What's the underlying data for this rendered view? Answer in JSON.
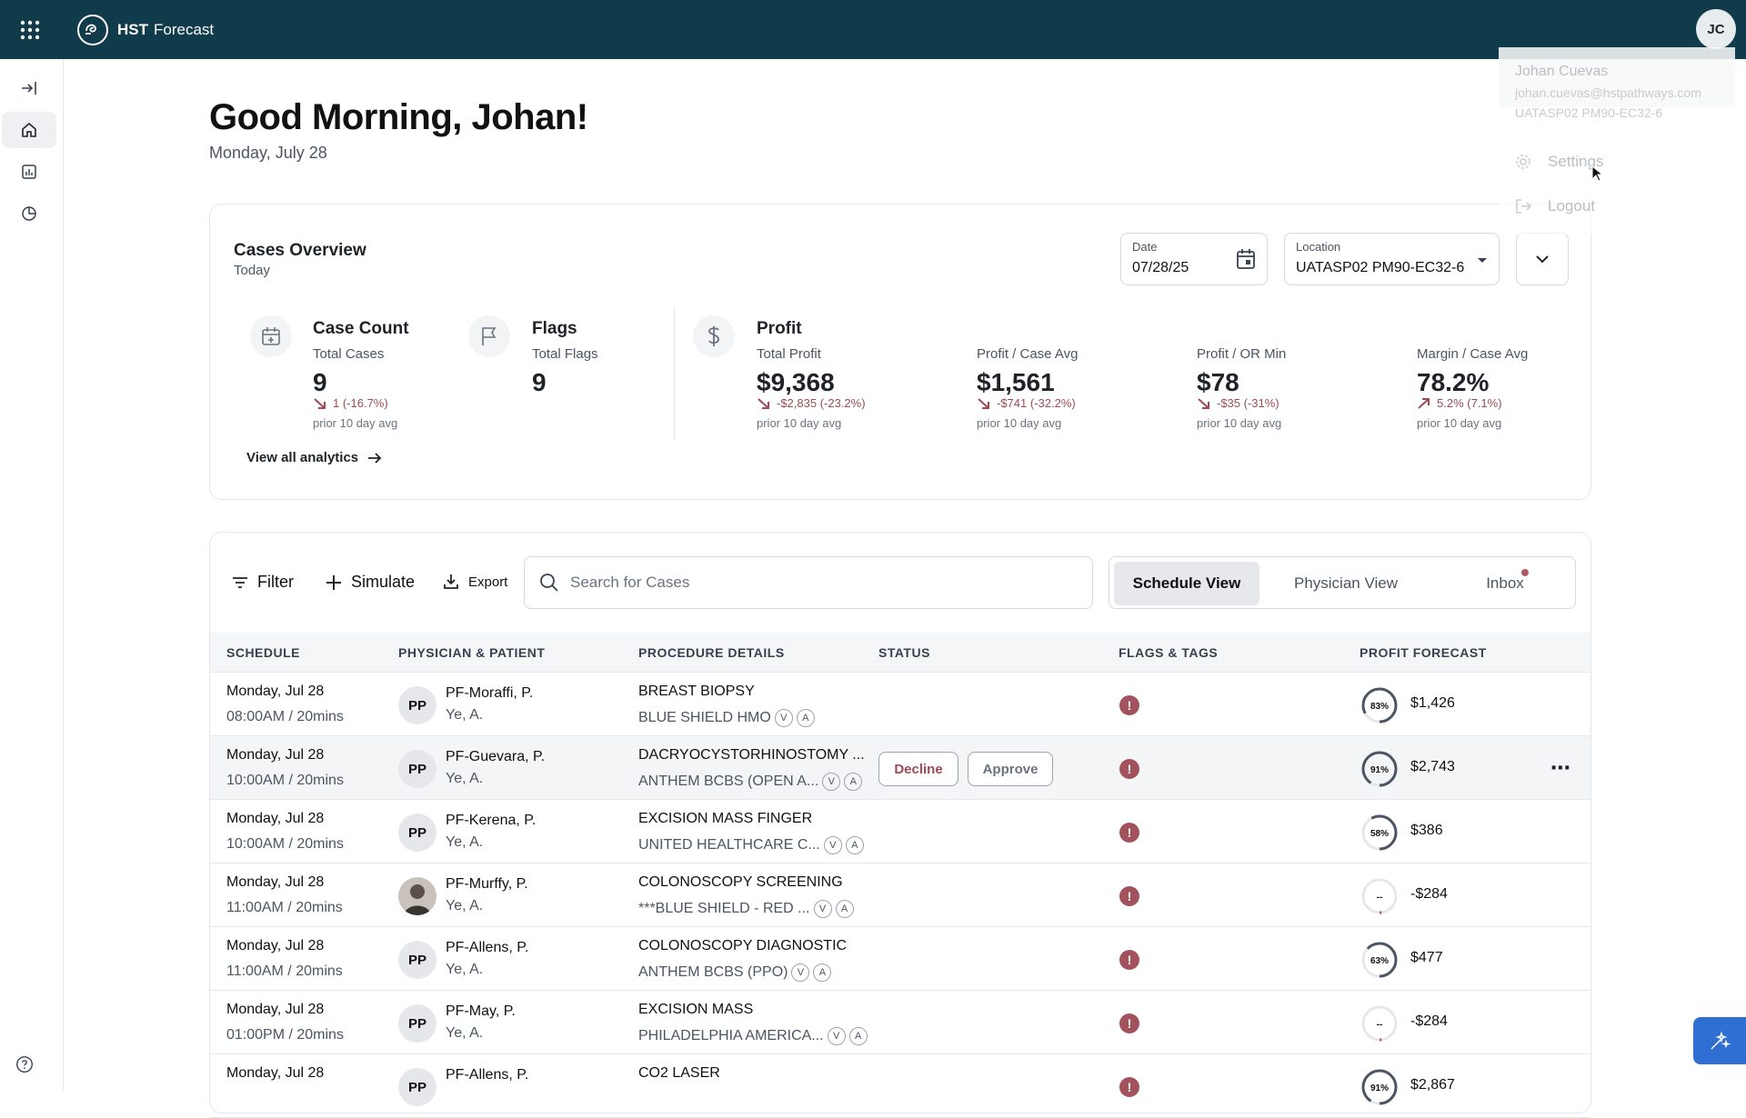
{
  "app": {
    "brand_bold": "HST",
    "brand_rest": "Forecast",
    "user_initials": "JC"
  },
  "greeting": {
    "title": "Good Morning, Johan!",
    "date": "Monday, July 28"
  },
  "overview": {
    "title": "Cases Overview",
    "subtitle": "Today",
    "date_label": "Date",
    "date_value": "07/28/25",
    "location_label": "Location",
    "location_value": "UATASP02 PM90-EC32-6",
    "view_all": "View all analytics",
    "case_count": {
      "title": "Case Count",
      "label": "Total Cases",
      "value": "9",
      "delta": "1 (-16.7%)",
      "prior": "prior 10 day avg"
    },
    "flags": {
      "title": "Flags",
      "label": "Total Flags",
      "value": "9"
    },
    "profit": {
      "title": "Profit",
      "label": "Total Profit",
      "value": "$9,368",
      "delta": "-$2,835 (-23.2%)",
      "prior": "prior 10 day avg"
    },
    "profit_case": {
      "label": "Profit / Case Avg",
      "value": "$1,561",
      "delta": "-$741 (-32.2%)",
      "prior": "prior 10 day avg"
    },
    "profit_or": {
      "label": "Profit / OR Min",
      "value": "$78",
      "delta": "-$35 (-31%)",
      "prior": "prior 10 day avg"
    },
    "margin": {
      "label": "Margin / Case Avg",
      "value": "78.2%",
      "delta": "5.2% (7.1%)",
      "prior": "prior 10 day avg"
    }
  },
  "toolbar": {
    "filter": "Filter",
    "simulate": "Simulate",
    "export": "Export",
    "search_placeholder": "Search for Cases",
    "tabs": [
      "Schedule View",
      "Physician View",
      "Inbox"
    ]
  },
  "table": {
    "headers": [
      "SCHEDULE",
      "PHYSICIAN & PATIENT",
      "PROCEDURE DETAILS",
      "STATUS",
      "FLAGS & TAGS",
      "PROFIT FORECAST"
    ],
    "decline": "Decline",
    "approve": "Approve",
    "chip_v": "V",
    "chip_a": "A",
    "rows": [
      {
        "date": "Monday, Jul 28",
        "time": "08:00AM / 20mins",
        "initials": "PP",
        "physician": "PF-Moraffi, P.",
        "patient": "Ye, A.",
        "procedure": "BREAST BIOPSY",
        "payer": "BLUE SHIELD HMO",
        "ring": "83%",
        "ring_value": 0.83,
        "profit": "$1,426"
      },
      {
        "date": "Monday, Jul 28",
        "time": "10:00AM / 20mins",
        "initials": "PP",
        "physician": "PF-Guevara, P.",
        "patient": "Ye, A.",
        "procedure": "DACRYOCYSTORHINOSTOMY ...",
        "payer": "ANTHEM BCBS (OPEN A...",
        "ring": "91%",
        "ring_value": 0.91,
        "profit": "$2,743"
      },
      {
        "date": "Monday, Jul 28",
        "time": "10:00AM / 20mins",
        "initials": "PP",
        "physician": "PF-Kerena, P.",
        "patient": "Ye, A.",
        "procedure": "EXCISION MASS FINGER",
        "payer": "UNITED HEALTHCARE C...",
        "ring": "58%",
        "ring_value": 0.58,
        "profit": "$386"
      },
      {
        "date": "Monday, Jul 28",
        "time": "11:00AM / 20mins",
        "initials": "",
        "physician": "PF-Murffy, P.",
        "patient": "Ye, A.",
        "procedure": "COLONOSCOPY SCREENING",
        "payer": "***BLUE SHIELD - RED ...",
        "ring": "--",
        "ring_value": 0,
        "profit": "-$284"
      },
      {
        "date": "Monday, Jul 28",
        "time": "11:00AM / 20mins",
        "initials": "PP",
        "physician": "PF-Allens, P.",
        "patient": "Ye, A.",
        "procedure": "COLONOSCOPY DIAGNOSTIC",
        "payer": "ANTHEM BCBS (PPO)",
        "ring": "63%",
        "ring_value": 0.63,
        "profit": "$477"
      },
      {
        "date": "Monday, Jul 28",
        "time": "01:00PM / 20mins",
        "initials": "PP",
        "physician": "PF-May, P.",
        "patient": "Ye, A.",
        "procedure": "EXCISION MASS",
        "payer": "PHILADELPHIA AMERICA...",
        "ring": "--",
        "ring_value": 0,
        "profit": "-$284"
      },
      {
        "date": "Monday, Jul 28",
        "time": "",
        "initials": "PP",
        "physician": "PF-Allens, P.",
        "patient": "",
        "procedure": "CO2 LASER",
        "payer": "",
        "ring": "91%",
        "ring_value": 0.91,
        "profit": "$2,867"
      }
    ]
  },
  "user_menu": {
    "name": "Johan Cuevas",
    "email": "johan.cuevas@hstpathways.com",
    "location": "UATASP02 PM90-EC32-6",
    "settings": "Settings",
    "logout": "Logout"
  },
  "colors": {
    "topbar": "#0f3b4a",
    "flag": "#a3525d",
    "fab": "#2f6fd1",
    "negative": "#9b4b57"
  }
}
